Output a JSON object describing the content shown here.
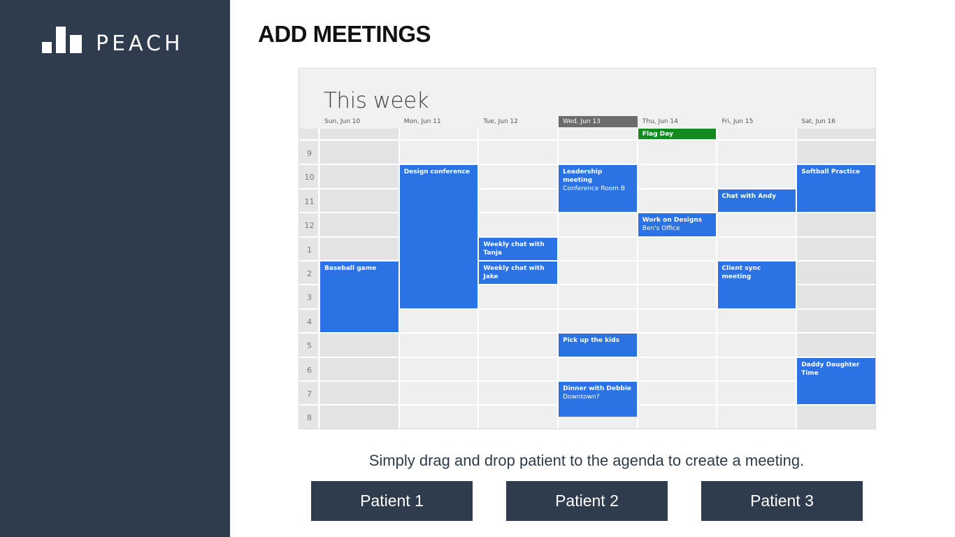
{
  "brand": {
    "name": "PEACH"
  },
  "page": {
    "title": "ADD MEETINGS"
  },
  "calendar": {
    "title": "This week",
    "days": [
      "Sun, Jun 10",
      "Mon, Jun 11",
      "Tue, Jun 12",
      "Wed, Jun 13",
      "Thu, Jun 14",
      "Fri, Jun 15",
      "Sat, Jun 16"
    ],
    "today": "Wed, Jun 13",
    "hours": [
      "9",
      "10",
      "11",
      "12",
      "1",
      "2",
      "3",
      "4",
      "5",
      "6",
      "7",
      "8"
    ],
    "all_day_events": [
      {
        "title": "Flag Day",
        "day": "Thu, Jun 14"
      }
    ],
    "events": [
      {
        "title": "Baseball game",
        "subtitle": "",
        "day": "Sun, Jun 10",
        "start": "2",
        "duration_hours": 3
      },
      {
        "title": "Design conference",
        "subtitle": "",
        "day": "Mon, Jun 11",
        "start": "10",
        "duration_hours": 6
      },
      {
        "title": "Weekly chat with Tanja",
        "subtitle": "",
        "day": "Tue, Jun 12",
        "start": "1",
        "duration_hours": 1
      },
      {
        "title": "Weekly chat with Jake",
        "subtitle": "",
        "day": "Tue, Jun 12",
        "start": "2",
        "duration_hours": 1
      },
      {
        "title": "Leadership meeting",
        "subtitle": "Conference Room B",
        "day": "Wed, Jun 13",
        "start": "10",
        "duration_hours": 2
      },
      {
        "title": "Pick up the kids",
        "subtitle": "",
        "day": "Wed, Jun 13",
        "start": "5",
        "duration_hours": 1
      },
      {
        "title": "Dinner with Debbie",
        "subtitle": "Downtown?",
        "day": "Wed, Jun 13",
        "start": "7",
        "duration_hours": 1.5
      },
      {
        "title": "Work on Designs",
        "subtitle": "Ben's Office",
        "day": "Thu, Jun 14",
        "start": "12",
        "duration_hours": 1
      },
      {
        "title": "Chat with Andy",
        "subtitle": "",
        "day": "Fri, Jun 15",
        "start": "11",
        "duration_hours": 1
      },
      {
        "title": "Client sync meeting",
        "subtitle": "",
        "day": "Fri, Jun 15",
        "start": "2",
        "duration_hours": 2
      },
      {
        "title": "Softball Practice",
        "subtitle": "",
        "day": "Sat, Jun 16",
        "start": "10",
        "duration_hours": 2
      },
      {
        "title": "Daddy Daughter Time",
        "subtitle": "",
        "day": "Sat, Jun 16",
        "start": "6",
        "duration_hours": 2
      }
    ],
    "colors": {
      "event": "#2b72e4",
      "all_day": "#128a1f",
      "today_header": "#6b6b6b"
    }
  },
  "hint": "Simply drag and drop patient to the agenda to create a meeting.",
  "patients": [
    "Patient 1",
    "Patient 2",
    "Patient 3"
  ]
}
